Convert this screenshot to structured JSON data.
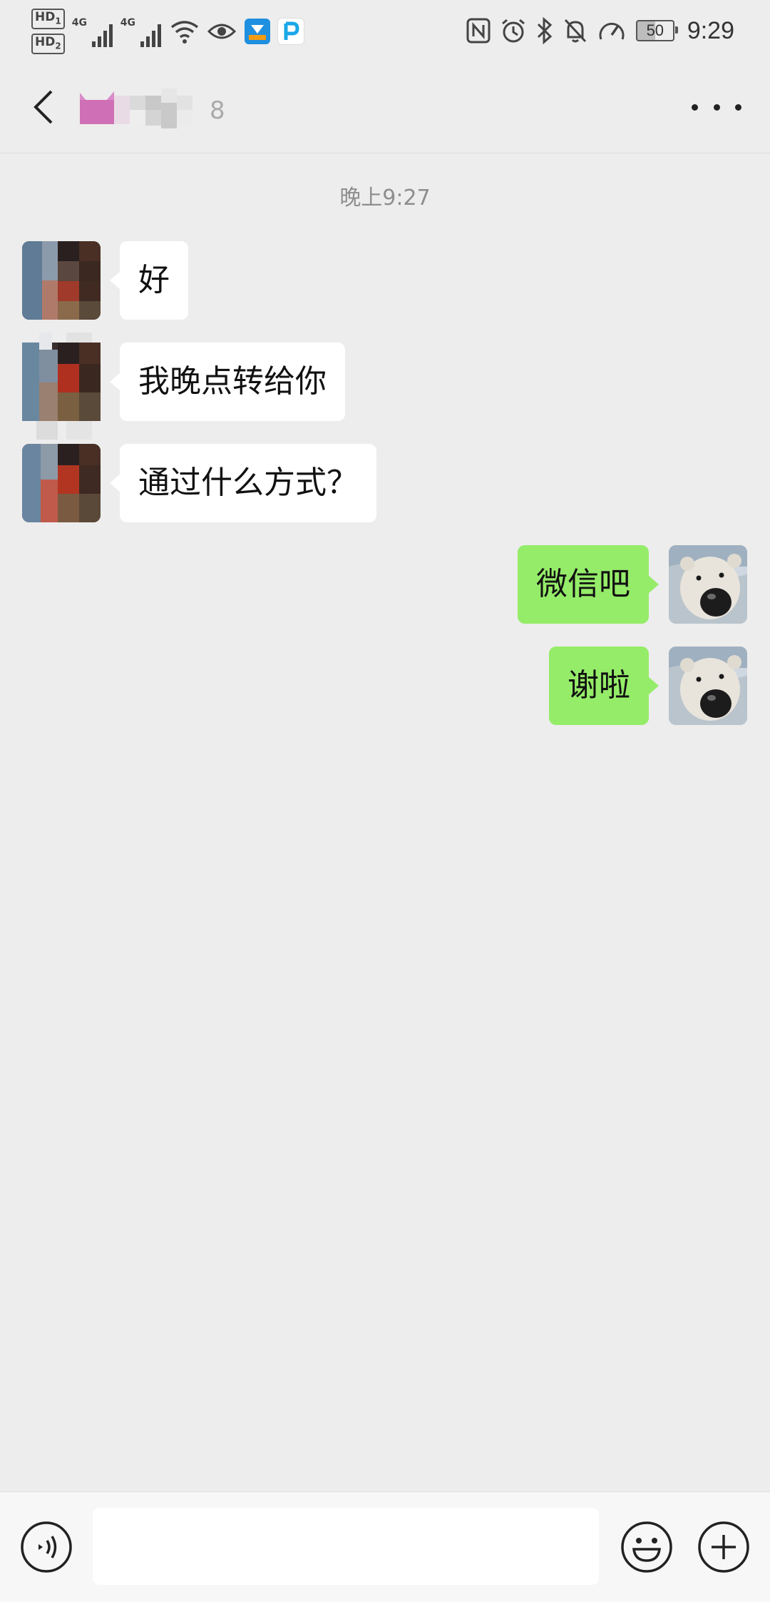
{
  "status_bar": {
    "sim1": "HD",
    "sim1_index": "1",
    "sim2": "HD",
    "sim2_index": "2",
    "net1": "4G",
    "net2": "4G",
    "battery_level": "50",
    "time": "9:29",
    "icons": [
      "wifi-icon",
      "eye-icon",
      "app-badge-icon",
      "app-p-icon",
      "nfc-icon",
      "alarm-icon",
      "bluetooth-icon",
      "mute-bell-icon",
      "speedometer-icon",
      "battery-icon"
    ]
  },
  "header": {
    "contact_name": "",
    "back_icon": "chevron-left-icon",
    "more_icon": "more-dots-icon"
  },
  "chat": {
    "timestamp": "晚上9:27",
    "messages": [
      {
        "direction": "in",
        "text": "好"
      },
      {
        "direction": "in",
        "text": "我晚点转给你"
      },
      {
        "direction": "in",
        "text": "通过什么方式？"
      },
      {
        "direction": "out",
        "text": "微信吧"
      },
      {
        "direction": "out",
        "text": "谢啦"
      }
    ]
  },
  "input_bar": {
    "placeholder": "",
    "voice_icon": "voice-icon",
    "emoji_icon": "emoji-icon",
    "plus_icon": "plus-icon"
  },
  "colors": {
    "background": "#ededed",
    "incoming_bubble": "#ffffff",
    "outgoing_bubble": "#95ec69",
    "timestamp": "#8e8e8e"
  }
}
